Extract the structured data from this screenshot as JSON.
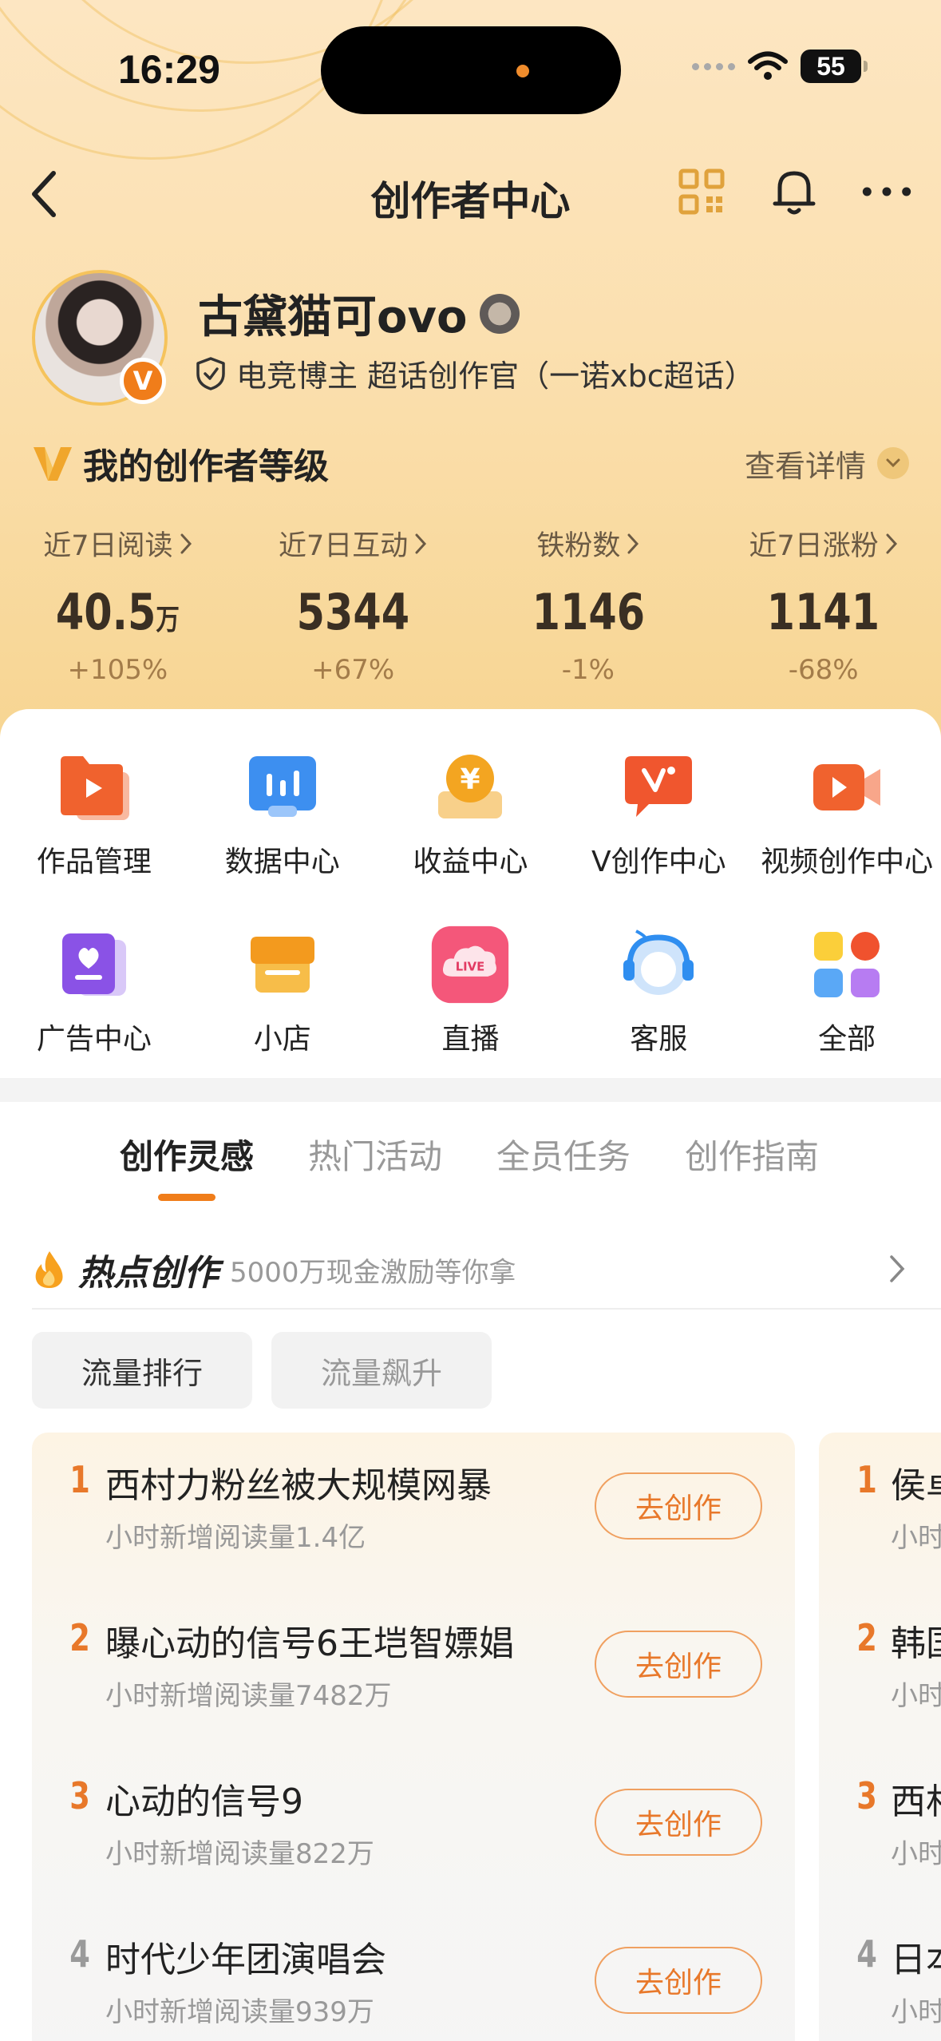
{
  "status_bar": {
    "time": "16:29",
    "battery": "55"
  },
  "nav": {
    "title": "创作者中心",
    "back_icon": "chevron-left-icon",
    "qr_icon": "qr-code-icon",
    "bell_icon": "bell-icon",
    "more_icon": "more-icon"
  },
  "profile": {
    "name": "古黛猫可ovo",
    "avatar_badge": "V",
    "tag": "电竞博主 超话创作官（一诺xbc超话）"
  },
  "level": {
    "title": "我的创作者等级",
    "more": "查看详情"
  },
  "stats": [
    {
      "label": "近7日阅读",
      "value": "40.5",
      "unit": "万",
      "change": "+105%"
    },
    {
      "label": "近7日互动",
      "value": "5344",
      "unit": "",
      "change": "+67%"
    },
    {
      "label": "铁粉数",
      "value": "1146",
      "unit": "",
      "change": "-1%"
    },
    {
      "label": "近7日涨粉",
      "value": "1141",
      "unit": "",
      "change": "-68%"
    }
  ],
  "tools": [
    {
      "label": "作品管理",
      "icon": "works-icon"
    },
    {
      "label": "数据中心",
      "icon": "data-icon"
    },
    {
      "label": "收益中心",
      "icon": "income-icon"
    },
    {
      "label": "V创作中心",
      "icon": "v-create-icon"
    },
    {
      "label": "视频创作中心",
      "icon": "video-icon"
    },
    {
      "label": "广告中心",
      "icon": "ad-icon"
    },
    {
      "label": "小店",
      "icon": "shop-icon"
    },
    {
      "label": "直播",
      "icon": "live-icon",
      "icon_text": "LIVE"
    },
    {
      "label": "客服",
      "icon": "support-icon"
    },
    {
      "label": "全部",
      "icon": "all-icon"
    }
  ],
  "tabs": [
    {
      "label": "创作灵感",
      "active": true
    },
    {
      "label": "热门活动",
      "active": false
    },
    {
      "label": "全员任务",
      "active": false
    },
    {
      "label": "创作指南",
      "active": false
    }
  ],
  "hot": {
    "title": "热点创作",
    "subtitle": "5000万现金激励等你拿"
  },
  "chips": [
    {
      "label": "流量排行",
      "active": true
    },
    {
      "label": "流量飙升",
      "active": false
    }
  ],
  "ranking": [
    {
      "rank": "1",
      "title": "西村力粉丝被大规模网暴",
      "sub": "小时新增阅读量1.4亿",
      "button": "去创作"
    },
    {
      "rank": "2",
      "title": "曝心动的信号6王垲智嫖娼",
      "sub": "小时新增阅读量7482万",
      "button": "去创作"
    },
    {
      "rank": "3",
      "title": "心动的信号9",
      "sub": "小时新增阅读量822万",
      "button": "去创作"
    },
    {
      "rank": "4",
      "title": "时代少年团演唱会",
      "sub": "小时新增阅读量939万",
      "button": "去创作"
    }
  ],
  "ranking_peek": [
    {
      "rank": "1",
      "title": "侯卓",
      "sub": "小时"
    },
    {
      "rank": "2",
      "title": "韩国",
      "sub": "小时"
    },
    {
      "rank": "3",
      "title": "西村",
      "sub": "小时"
    },
    {
      "rank": "4",
      "title": "日本",
      "sub": "小时"
    }
  ],
  "colors": {
    "accent": "#f07d1a",
    "rank_top": "#e8782a",
    "rank_other": "#9a9a9a"
  }
}
